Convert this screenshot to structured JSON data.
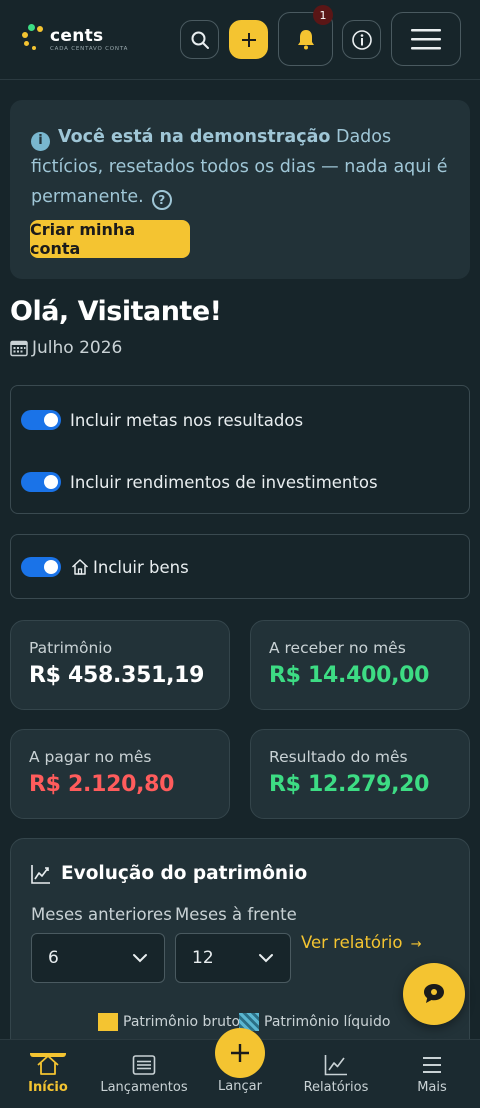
{
  "header": {
    "brand": "cents",
    "tagline": "CADA CENTAVO CONTA",
    "notification_count": "1"
  },
  "demo": {
    "title": "Você está na demonstração",
    "message": "Dados fictícios, resetados todos os dias — nada aqui é permanente.",
    "cta_label": "Criar minha conta"
  },
  "greeting": "Olá, Visitante!",
  "period": "Julho 2026",
  "toggles": {
    "goals": "Incluir metas nos resultados",
    "investments": "Incluir rendimentos de investimentos",
    "assets": "Incluir bens"
  },
  "cards": {
    "patrimonio": {
      "label": "Patrimônio",
      "value": "R$ 458.351,19"
    },
    "receber": {
      "label": "A receber no mês",
      "value": "R$ 14.400,00"
    },
    "pagar": {
      "label": "A pagar no mês",
      "value": "R$ 2.120,80"
    },
    "resultado": {
      "label": "Resultado do mês",
      "value": "R$ 12.279,20"
    }
  },
  "evolution": {
    "title": "Evolução do patrimônio",
    "prev_label": "Meses anteriores",
    "next_label": "Meses à frente",
    "prev_value": "6",
    "next_value": "12",
    "report_link": "Ver relatório",
    "legend_gross": "Patrimônio bruto",
    "legend_net": "Patrimônio líquido"
  },
  "nav": {
    "home": "Início",
    "entries": "Lançamentos",
    "add": "Lançar",
    "reports": "Relatórios",
    "more": "Mais"
  },
  "colors": {
    "accent": "#f4c431",
    "positive": "#3ddc84",
    "negative": "#ff5c5c",
    "toggle": "#1a73e8",
    "background": "#17252a",
    "card": "#223238"
  }
}
